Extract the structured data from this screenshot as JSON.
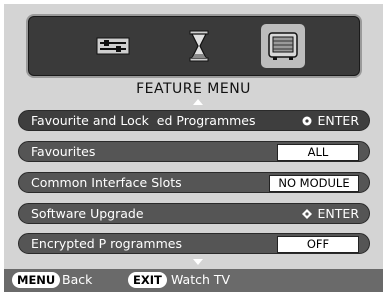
{
  "header": {
    "icons": [
      {
        "name": "settings-sliders-icon",
        "selected": false
      },
      {
        "name": "hourglass-icon",
        "selected": false
      },
      {
        "name": "tv-feature-icon",
        "selected": true
      }
    ],
    "title": "FEATURE MENU"
  },
  "menu": {
    "items": [
      {
        "label": "Favourite and Lock  ed Programmes",
        "type": "enter",
        "value": "ENTER"
      },
      {
        "label": "Favourites",
        "type": "value",
        "value": "ALL"
      },
      {
        "label": "Common Interface Slots",
        "type": "value",
        "value": "NO MODULE"
      },
      {
        "label": "Software Upgrade",
        "type": "enter",
        "value": "ENTER"
      },
      {
        "label": "Encrypted P rogrammes",
        "type": "value",
        "value": "OFF"
      }
    ]
  },
  "footer": {
    "menu_key": "MENU",
    "menu_action": "Back",
    "exit_key": "EXIT",
    "exit_action": "Watch TV"
  },
  "colors": {
    "panel_bg": "#3a3a3a",
    "row_bg": "#555555",
    "footer_bg": "#6a6a6a",
    "screen_bg": "#d4d4d4"
  }
}
